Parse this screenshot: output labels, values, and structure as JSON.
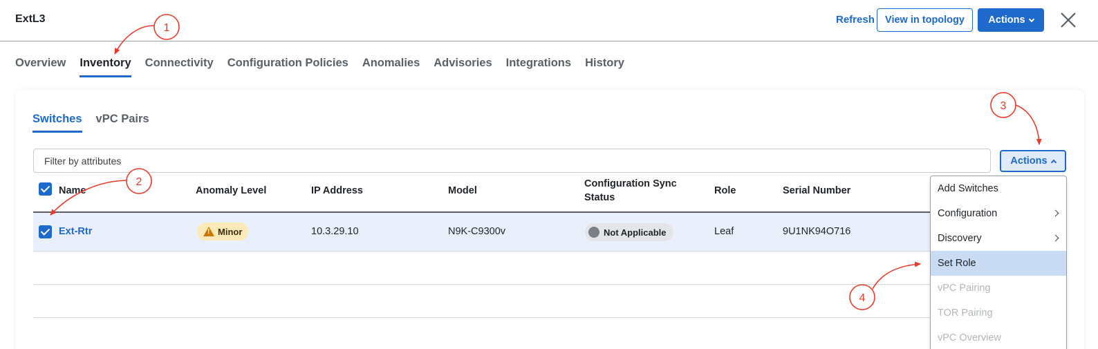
{
  "header": {
    "title": "ExtL3",
    "refresh_label": "Refresh",
    "view_topology_label": "View in topology",
    "actions_label": "Actions"
  },
  "tabs": [
    {
      "label": "Overview",
      "active": false
    },
    {
      "label": "Inventory",
      "active": true
    },
    {
      "label": "Connectivity",
      "active": false
    },
    {
      "label": "Configuration Policies",
      "active": false
    },
    {
      "label": "Anomalies",
      "active": false
    },
    {
      "label": "Advisories",
      "active": false
    },
    {
      "label": "Integrations",
      "active": false
    },
    {
      "label": "History",
      "active": false
    }
  ],
  "subtabs": [
    {
      "label": "Switches",
      "active": true
    },
    {
      "label": "vPC Pairs",
      "active": false
    }
  ],
  "filter": {
    "placeholder": "Filter by attributes"
  },
  "table_actions_label": "Actions",
  "table": {
    "columns": [
      "Name",
      "Anomaly Level",
      "IP Address",
      "Model",
      "Configuration Sync Status",
      "Role",
      "Serial Number"
    ],
    "rows": [
      {
        "name": "Ext-Rtr",
        "anomaly_level": "Minor",
        "ip": "10.3.29.10",
        "model": "N9K-C9300v",
        "sync_status": "Not Applicable",
        "role": "Leaf",
        "serial": "9U1NK94O716",
        "selected": true
      }
    ]
  },
  "actions_menu": [
    {
      "label": "Add Switches",
      "submenu": false,
      "disabled": false,
      "highlighted": false
    },
    {
      "label": "Configuration",
      "submenu": true,
      "disabled": false,
      "highlighted": false
    },
    {
      "label": "Discovery",
      "submenu": true,
      "disabled": false,
      "highlighted": false
    },
    {
      "label": "Set Role",
      "submenu": false,
      "disabled": false,
      "highlighted": true
    },
    {
      "label": "vPC Pairing",
      "submenu": false,
      "disabled": true,
      "highlighted": false
    },
    {
      "label": "TOR Pairing",
      "submenu": false,
      "disabled": true,
      "highlighted": false
    },
    {
      "label": "vPC Overview",
      "submenu": false,
      "disabled": true,
      "highlighted": false
    }
  ],
  "annotations": [
    "1",
    "2",
    "3",
    "4"
  ],
  "colors": {
    "accent": "#1d69cc",
    "annotation": "#e83a2a",
    "minor_badge": "#fbeab8",
    "highlight": "#c9dcf4"
  }
}
